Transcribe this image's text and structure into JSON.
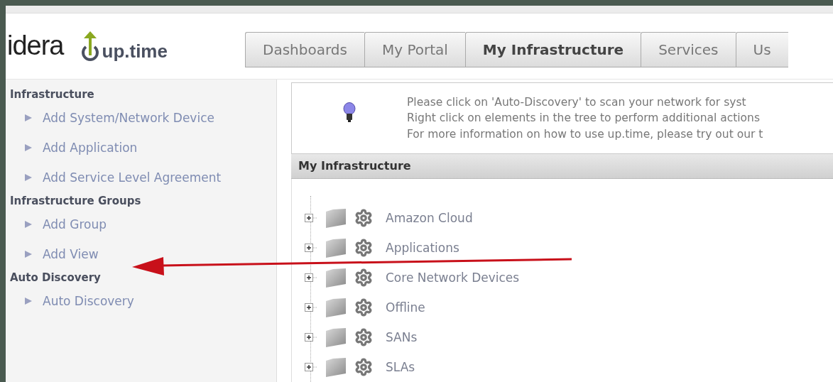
{
  "logo": {
    "brand": "idera",
    "product": "up.time"
  },
  "tabs": [
    {
      "label": "Dashboards",
      "selected": false
    },
    {
      "label": "My Portal",
      "selected": false
    },
    {
      "label": "My Infrastructure",
      "selected": true
    },
    {
      "label": "Services",
      "selected": false
    },
    {
      "label": "Us",
      "selected": false
    }
  ],
  "sidebar": {
    "sections": [
      {
        "title": "Infrastructure",
        "items": [
          "Add System/Network Device",
          "Add Application",
          "Add Service Level Agreement"
        ]
      },
      {
        "title": "Infrastructure Groups",
        "items": [
          "Add Group",
          "Add View"
        ]
      },
      {
        "title": "Auto Discovery",
        "items": [
          "Auto Discovery"
        ]
      }
    ]
  },
  "info": {
    "lines": [
      "Please click on 'Auto-Discovery' to scan your network for syst",
      "Right click on elements in the tree to perform additional actions",
      "For more information on how to use up.time, please try out our t"
    ]
  },
  "panel": {
    "title": "My Infrastructure",
    "tree": [
      {
        "label": "Amazon Cloud",
        "expanded": false
      },
      {
        "label": "Applications",
        "expanded": false
      },
      {
        "label": "Core Network Devices",
        "expanded": false
      },
      {
        "label": "Offline",
        "expanded": false
      },
      {
        "label": "SANs",
        "expanded": false
      },
      {
        "label": "SLAs",
        "expanded": false
      }
    ]
  }
}
